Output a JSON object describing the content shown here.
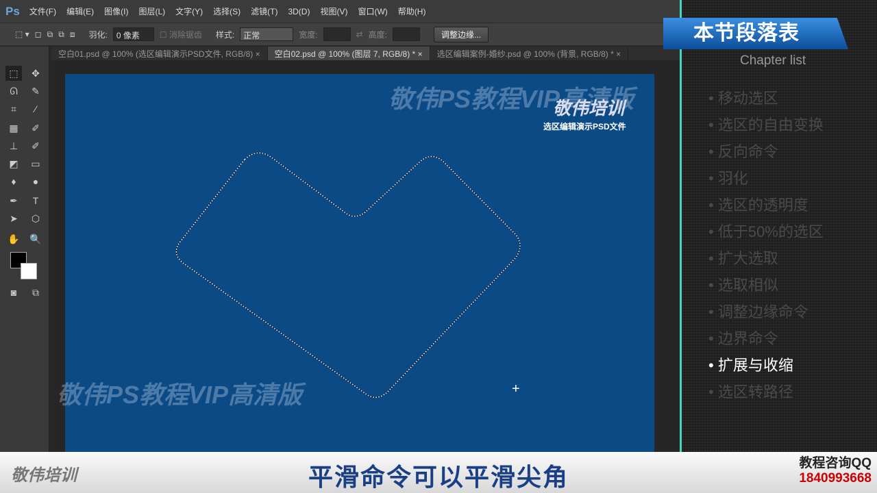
{
  "app": {
    "logo": "Ps",
    "menu": [
      "文件(F)",
      "编辑(E)",
      "图像(I)",
      "图层(L)",
      "文字(Y)",
      "选择(S)",
      "滤镜(T)",
      "3D(D)",
      "视图(V)",
      "窗口(W)",
      "帮助(H)"
    ]
  },
  "options": {
    "feather_label": "羽化:",
    "feather_value": "0 像素",
    "antialias_label": "消除锯齿",
    "style_label": "样式:",
    "style_value": "正常",
    "width_label": "宽度:",
    "height_label": "高度:",
    "refine_button": "调整边缘..."
  },
  "tabs": [
    {
      "label": "空白01.psd @ 100% (选区编辑演示PSD文件, RGB/8)"
    },
    {
      "label": "空白02.psd @ 100% (图层 7, RGB/8) *"
    },
    {
      "label": "选区编辑案例-婚纱.psd @ 100% (背景, RGB/8) *"
    }
  ],
  "canvas": {
    "watermark_top": "敬伟PS教程VIP高清版",
    "logo": "敬伟培训",
    "logo_sub": "选区编辑演示PSD文件",
    "watermark_bottom": "敬伟PS教程VIP高清版"
  },
  "panel": {
    "title": "本节段落表",
    "subtitle": "Chapter list",
    "items": [
      "移动选区",
      "选区的自由变换",
      "反向命令",
      "羽化",
      "选区的透明度",
      "低于50%的选区",
      "扩大选取",
      "选取相似",
      "调整边缘命令",
      "边界命令",
      "扩展与收缩",
      "选区转路径"
    ],
    "active_index": 10
  },
  "bottom": {
    "logo": "敬伟培训",
    "subtitle": "平滑命令可以平滑尖角",
    "qq_label": "教程咨询QQ",
    "qq_number": "1840993668"
  }
}
